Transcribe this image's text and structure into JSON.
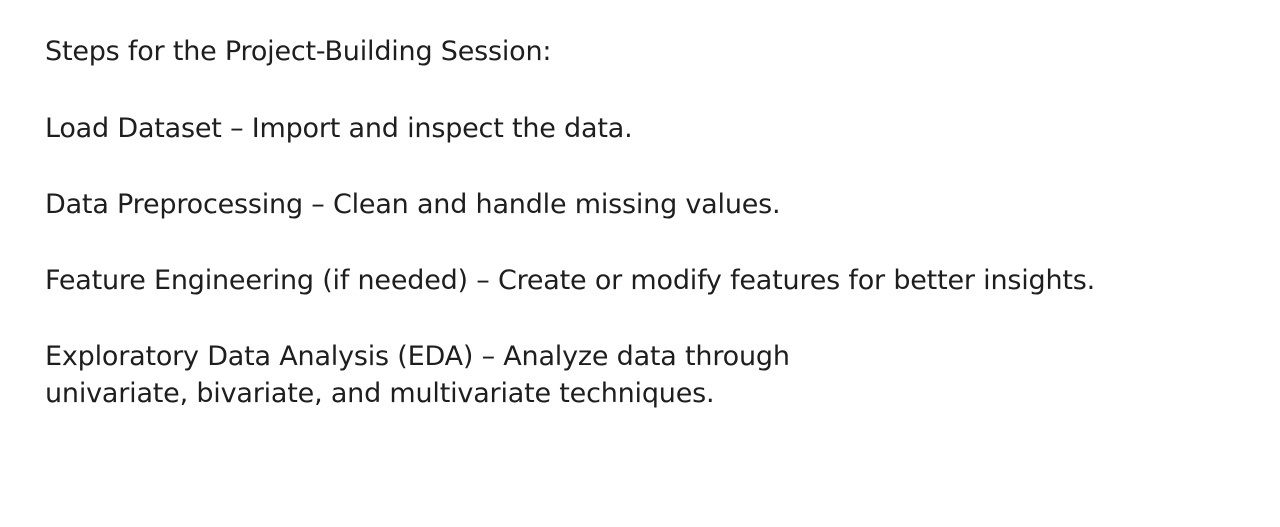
{
  "heading": "Steps for the Project-Building Session:",
  "steps": [
    "Load Dataset – Import and inspect the data.",
    "Data Preprocessing – Clean and handle missing values.",
    "Feature Engineering (if needed) – Create or modify features for better insights.",
    "Exploratory Data Analysis (EDA) – Analyze data through",
    "univariate, bivariate, and multivariate techniques."
  ],
  "colors": {
    "background": "#ffffff",
    "text": "#1e1e1e"
  }
}
